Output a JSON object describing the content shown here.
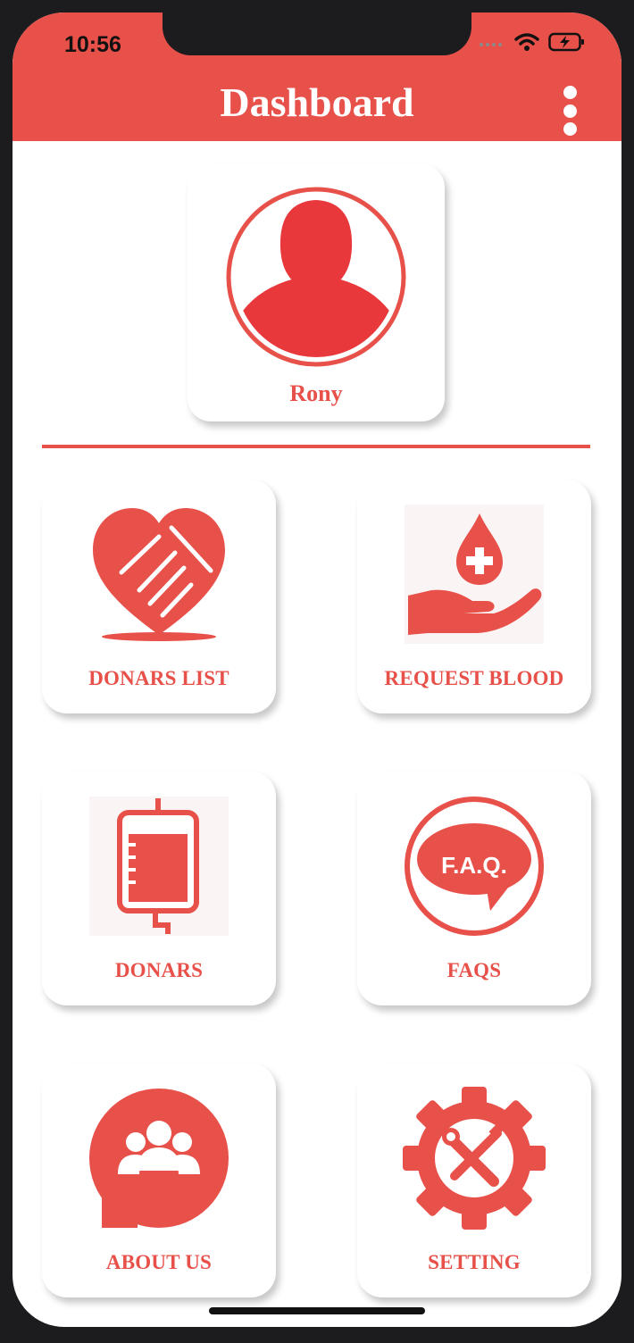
{
  "status_bar": {
    "time": "10:56"
  },
  "header": {
    "title": "Dashboard"
  },
  "profile": {
    "name": "Rony"
  },
  "tiles": [
    {
      "label": "DONARS LIST",
      "icon": "handshake-heart-icon"
    },
    {
      "label": "REQUEST BLOOD",
      "icon": "blood-drop-hand-icon"
    },
    {
      "label": "DONARS",
      "icon": "blood-bag-icon"
    },
    {
      "label": "FAQS",
      "icon": "faq-bubble-icon",
      "icon_text": "F.A.Q."
    },
    {
      "label": "ABOUT US",
      "icon": "group-chat-icon"
    },
    {
      "label": "SETTING",
      "icon": "gear-tools-icon"
    }
  ],
  "colors": {
    "accent": "#e8504a",
    "background": "#ffffff"
  }
}
